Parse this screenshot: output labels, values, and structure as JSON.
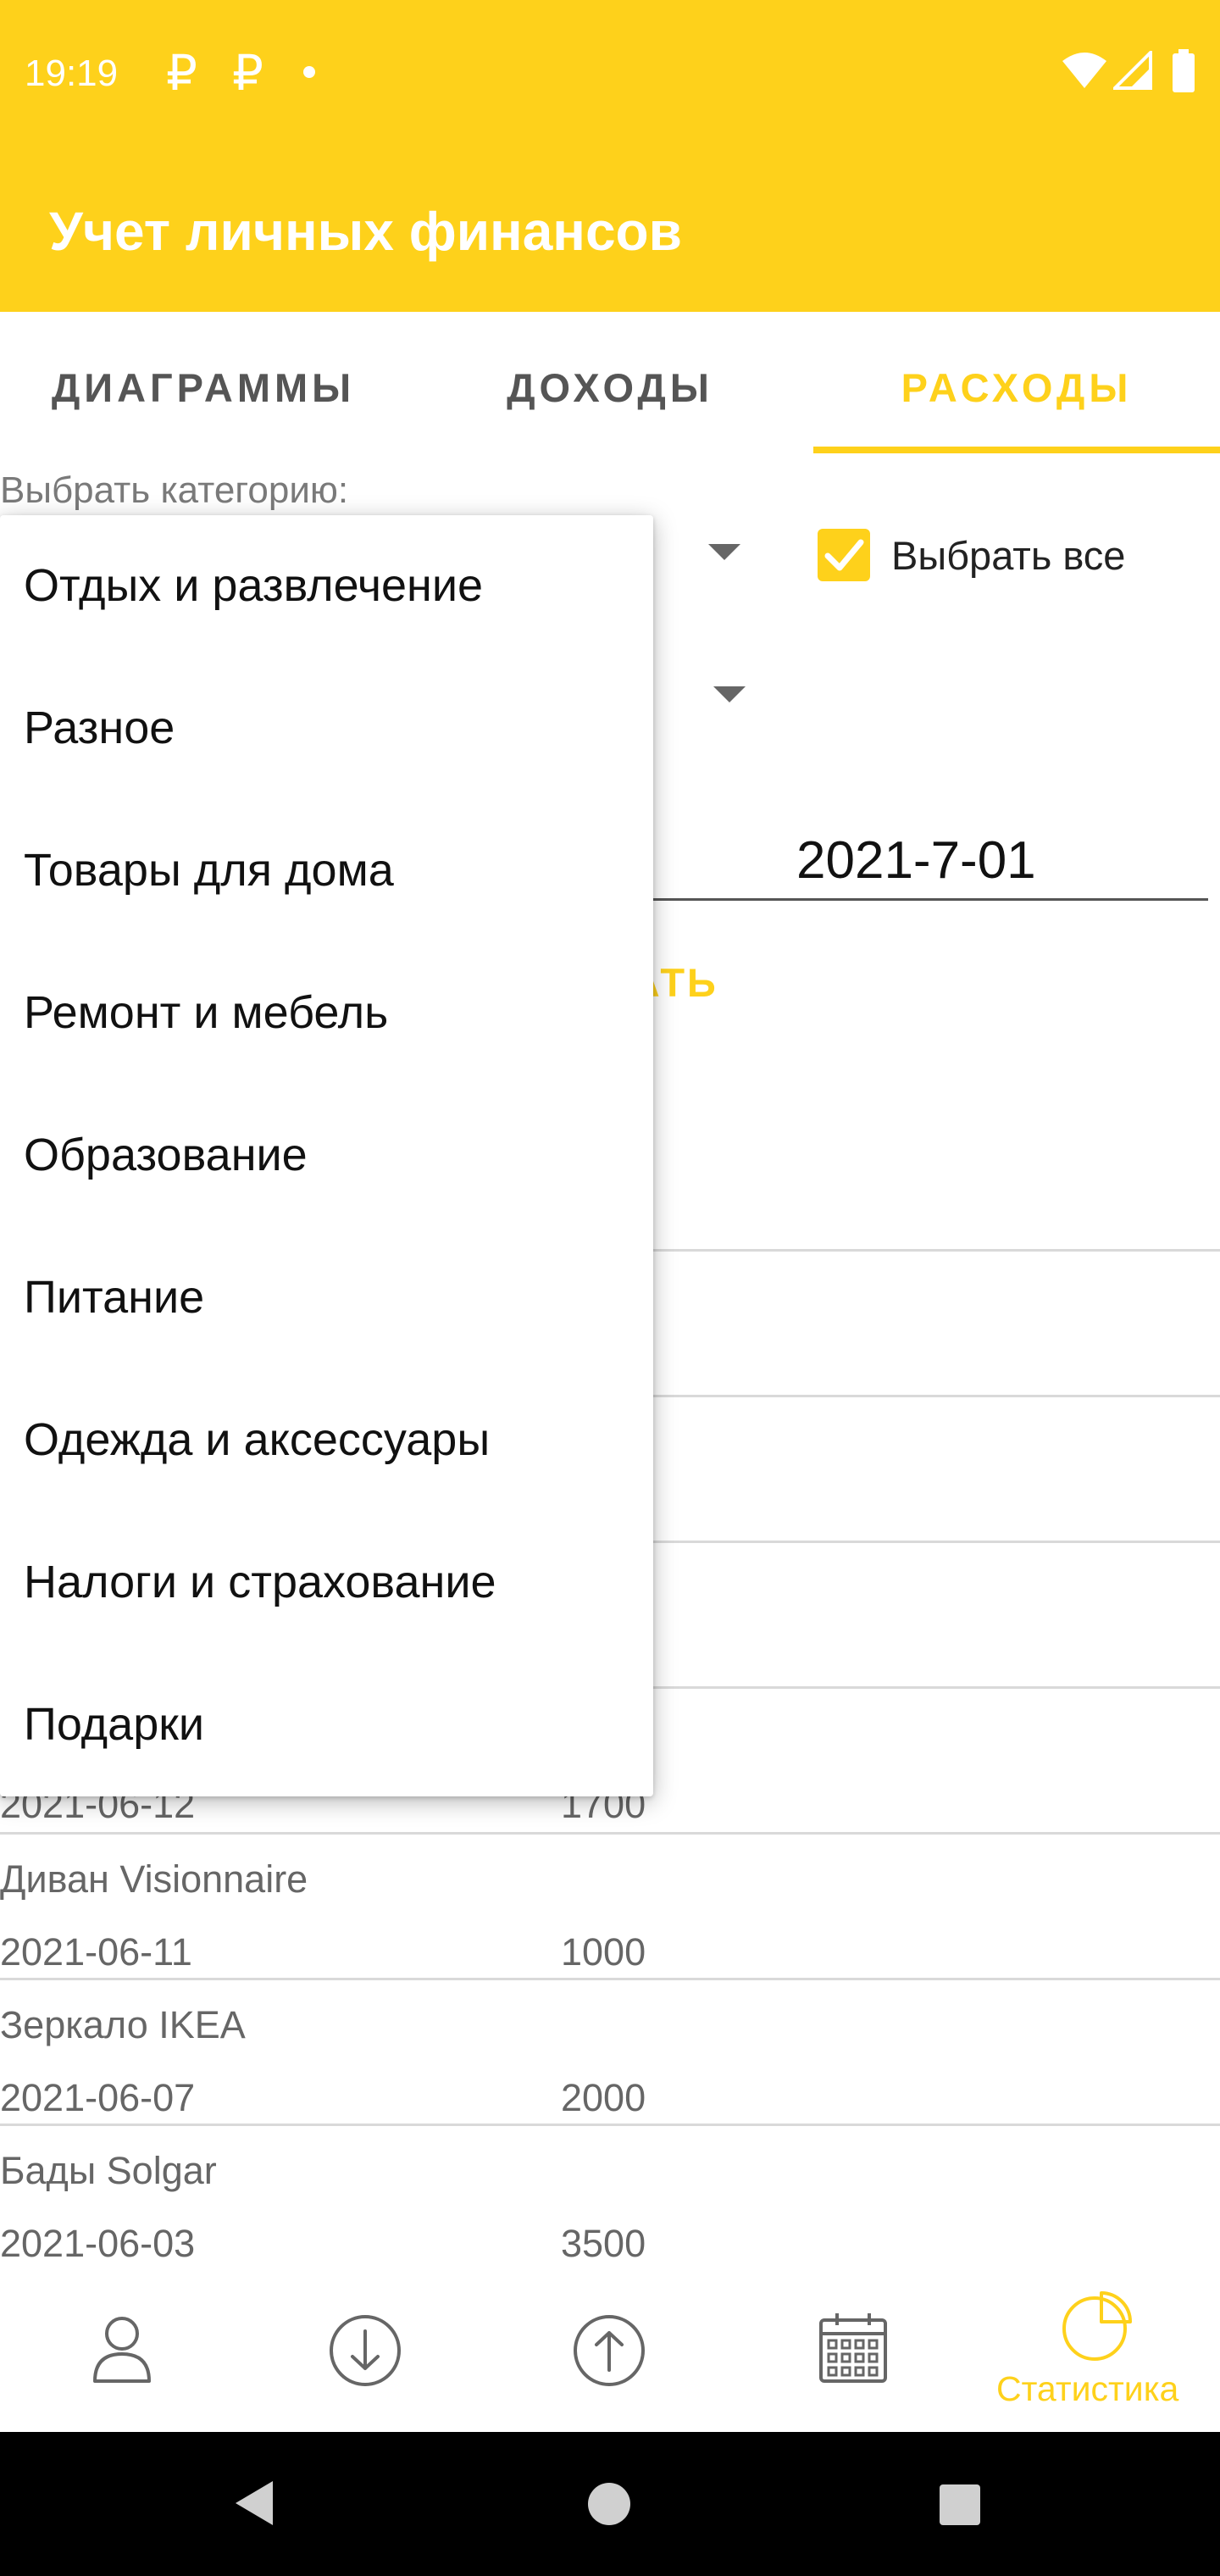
{
  "status_bar": {
    "time": "19:19",
    "notification_1": "₽",
    "notification_2": "₽"
  },
  "app_bar": {
    "title": "Учет личных финансов"
  },
  "tabs": [
    {
      "label": "ДИАГРАММЫ"
    },
    {
      "label": "ДОХОДЫ"
    },
    {
      "label": "РАСХОДЫ",
      "selected": true
    }
  ],
  "filter": {
    "category_label": "Выбрать категорию:",
    "select_all_label": "Выбрать все",
    "select_all_checked": true,
    "date_value": "2021-7-01",
    "show_button_visible_text": "ТАТЬ"
  },
  "dropdown": {
    "items": [
      "Отдых и развлечение",
      "Разное",
      "Товары для дома",
      "Ремонт и мебель",
      "Образование",
      "Питание",
      "Одежда и аксессуары",
      "Налоги и страхование",
      "Подарки"
    ]
  },
  "expenses": {
    "partial_row": {
      "date": "2021-06-12",
      "amount": "1700"
    },
    "rows": [
      {
        "title": "Диван Visionnaire",
        "date": "2021-06-11",
        "amount": "1000"
      },
      {
        "title": "Зеркало IKEA",
        "date": "2021-06-07",
        "amount": "2000"
      },
      {
        "title": "Бады Solgar",
        "date": "2021-06-03",
        "amount": "3500"
      }
    ]
  },
  "bottom_nav": {
    "items": [
      {
        "icon": "profile-icon"
      },
      {
        "icon": "income-arrow-down-icon"
      },
      {
        "icon": "expense-arrow-up-icon"
      },
      {
        "icon": "calendar-icon"
      },
      {
        "icon": "pie-chart-icon",
        "label": "Статистика",
        "selected": true
      }
    ]
  },
  "colors": {
    "accent": "#fed11b",
    "text_muted": "#666666"
  }
}
